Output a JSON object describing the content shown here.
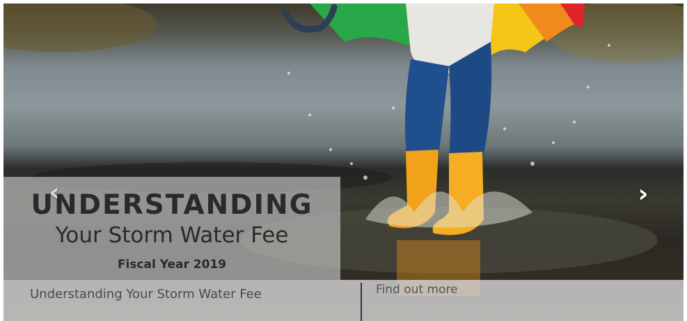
{
  "slide": {
    "image": "child-rain-boots-puddle-splash",
    "caption": {
      "line1": "UNDERSTANDING",
      "line2": "Your Storm Water Fee",
      "line3": "Fiscal Year 2019"
    }
  },
  "nav": {
    "prev_icon": "chevron-left-icon",
    "prev_glyph": "‹",
    "next_icon": "chevron-right-icon",
    "next_glyph": "›"
  },
  "bottom_bar": {
    "title": "Understanding Your Storm Water Fee",
    "link_label": "Find out more"
  },
  "colors": {
    "boots": "#f2a31a",
    "jeans": "#1f4f8c",
    "caption_text": "#2a2a2a"
  }
}
